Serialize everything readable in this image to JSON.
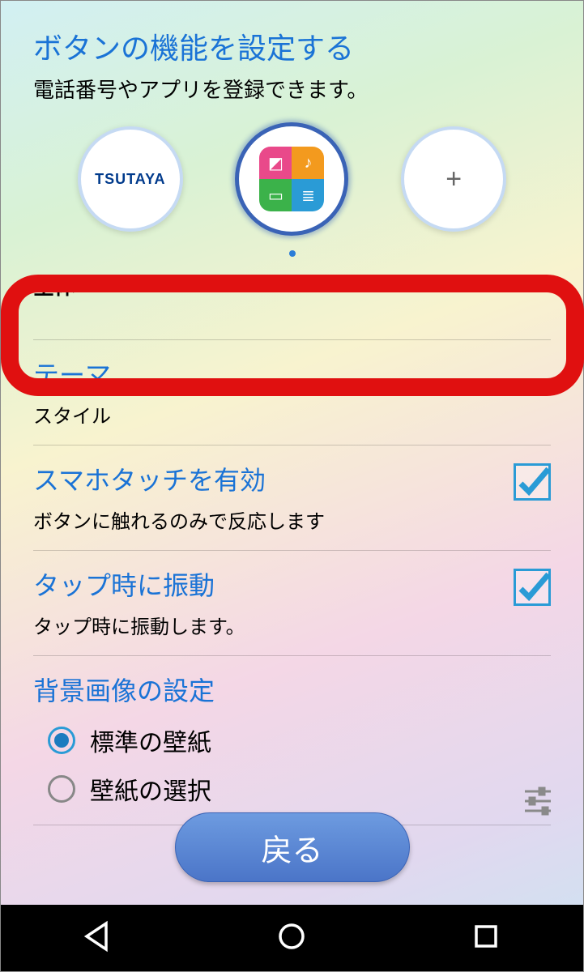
{
  "header": {
    "title": "ボタンの機能を設定する",
    "subtitle": "電話番号やアプリを登録できます。"
  },
  "shortcuts": {
    "slot1_label": "TSUTAYA",
    "slot3_label": "+"
  },
  "section_label": "全体",
  "list": {
    "theme": {
      "title": "テーマ",
      "subtitle": "スタイル"
    },
    "touch": {
      "title": "スマホタッチを有効",
      "subtitle": "ボタンに触れるのみで反応します"
    },
    "vibrate": {
      "title": "タップ時に振動",
      "subtitle": "タップ時に振動します。"
    },
    "background": {
      "title": "背景画像の設定",
      "option1": "標準の壁紙",
      "option2": "壁紙の選択"
    }
  },
  "back_button": "戻る"
}
